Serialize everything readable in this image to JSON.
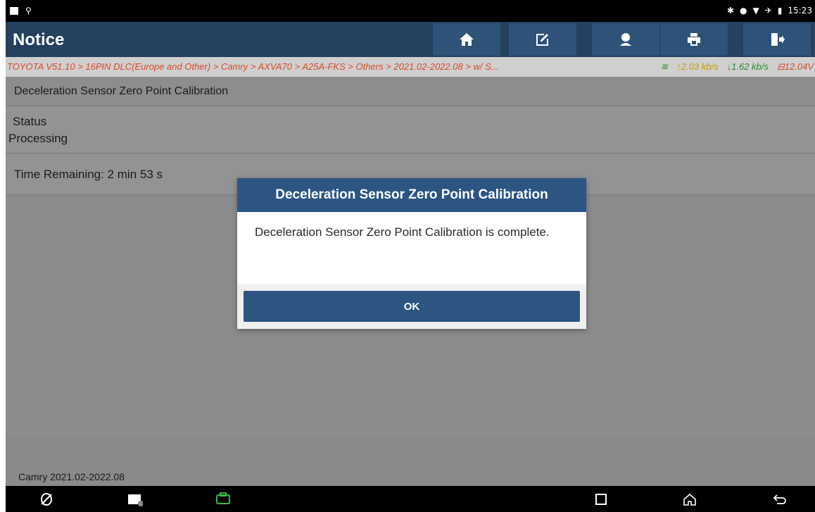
{
  "status_bar": {
    "time": "15:23"
  },
  "header": {
    "title": "Notice",
    "buttons": [
      "home-icon",
      "edit-report-icon",
      "support-icon",
      "print-icon",
      "exit-icon"
    ]
  },
  "breadcrumb": {
    "path": "TOYOTA V51.10 > 16PIN DLC(Europe and Other) > Camry > AXVA70 > A25A-FKS > Others > 2021.02-2022.08 > w/ S...",
    "upload": "2.03 kb/s",
    "download": "1.62 kb/s",
    "voltage": "12.04V"
  },
  "content": {
    "function_title": "Deceleration Sensor Zero Point Calibration",
    "status_label": "Status",
    "status_value": "Processing",
    "time_remaining": "Time Remaining: 2 min 53 s"
  },
  "footer": {
    "vehicle": "Camry 2021.02-2022.08"
  },
  "dialog": {
    "title": "Deceleration Sensor Zero Point Calibration",
    "message": "Deceleration Sensor Zero Point Calibration is complete.",
    "ok_label": "OK"
  },
  "colors": {
    "header": "#24415f",
    "dialog_accent": "#2c5582",
    "path_text": "#d94a2b"
  }
}
